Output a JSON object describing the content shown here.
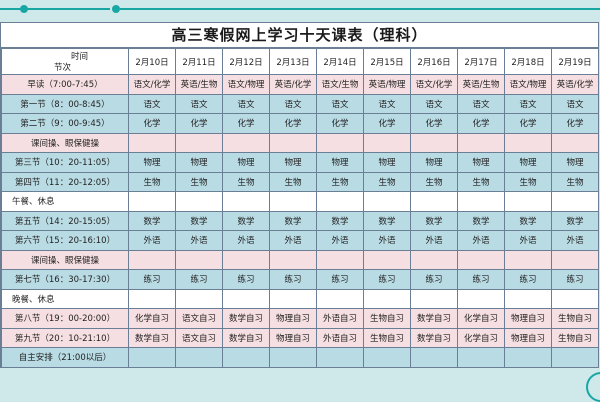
{
  "title": "高三寒假网上学习十天课表（理科）",
  "header": {
    "corner_top": "时间",
    "corner_bottom": "节次",
    "dates": [
      "2月10日",
      "2月11日",
      "2月12日",
      "2月13日",
      "2月14日",
      "2月15日",
      "2月16日",
      "2月17日",
      "2月18日",
      "2月19日"
    ]
  },
  "rows": [
    {
      "label": "早读（7:00-7:45）",
      "style": "pink",
      "cells": [
        "语文/化学",
        "英语/生物",
        "语文/物理",
        "英语/化学",
        "语文/生物",
        "英语/物理",
        "语文/化学",
        "英语/生物",
        "语文/物理",
        "英语/化学"
      ]
    },
    {
      "label": "第一节（8：00-8:45）",
      "style": "blue",
      "cells": [
        "语文",
        "语文",
        "语文",
        "语文",
        "语文",
        "语文",
        "语文",
        "语文",
        "语文",
        "语文"
      ]
    },
    {
      "label": "第二节（9：00-9:45）",
      "style": "blue",
      "cells": [
        "化学",
        "化学",
        "化学",
        "化学",
        "化学",
        "化学",
        "化学",
        "化学",
        "化学",
        "化学"
      ]
    },
    {
      "label": "课间操、眼保健操",
      "style": "pink",
      "cells": []
    },
    {
      "label": "第三节（10：20-11:05）",
      "style": "blue",
      "cells": [
        "物理",
        "物理",
        "物理",
        "物理",
        "物理",
        "物理",
        "物理",
        "物理",
        "物理",
        "物理"
      ]
    },
    {
      "label": "第四节（11：20-12:05）",
      "style": "blue",
      "cells": [
        "生物",
        "生物",
        "生物",
        "生物",
        "生物",
        "生物",
        "生物",
        "生物",
        "生物",
        "生物"
      ]
    },
    {
      "label": "午餐、休息",
      "style": "white",
      "cells": [],
      "indent": true
    },
    {
      "label": "第五节（14：20-15:05）",
      "style": "blue",
      "cells": [
        "数学",
        "数学",
        "数学",
        "数学",
        "数学",
        "数学",
        "数学",
        "数学",
        "数学",
        "数学"
      ]
    },
    {
      "label": "第六节（15：20-16:10）",
      "style": "blue",
      "cells": [
        "外语",
        "外语",
        "外语",
        "外语",
        "外语",
        "外语",
        "外语",
        "外语",
        "外语",
        "外语"
      ]
    },
    {
      "label": "课间操、眼保健操",
      "style": "pink",
      "cells": []
    },
    {
      "label": "第七节（16：30-17:30）",
      "style": "blue",
      "cells": [
        "练习",
        "练习",
        "练习",
        "练习",
        "练习",
        "练习",
        "练习",
        "练习",
        "练习",
        "练习"
      ]
    },
    {
      "label": "晚餐、休息",
      "style": "white",
      "cells": [],
      "indent": true
    },
    {
      "label": "第八节（19：00-20:00）",
      "style": "pink",
      "cells": [
        "化学自习",
        "语文自习",
        "数学自习",
        "物理自习",
        "外语自习",
        "生物自习",
        "数学自习",
        "化学自习",
        "物理自习",
        "生物自习"
      ]
    },
    {
      "label": "第九节（20：10-21:10）",
      "style": "pink",
      "cells": [
        "数学自习",
        "语文自习",
        "数学自习",
        "物理自习",
        "外语自习",
        "生物自习",
        "数学自习",
        "化学自习",
        "物理自习",
        "生物自习"
      ]
    },
    {
      "label": "自主安排（21:00以后）",
      "style": "blue",
      "cells": []
    }
  ]
}
